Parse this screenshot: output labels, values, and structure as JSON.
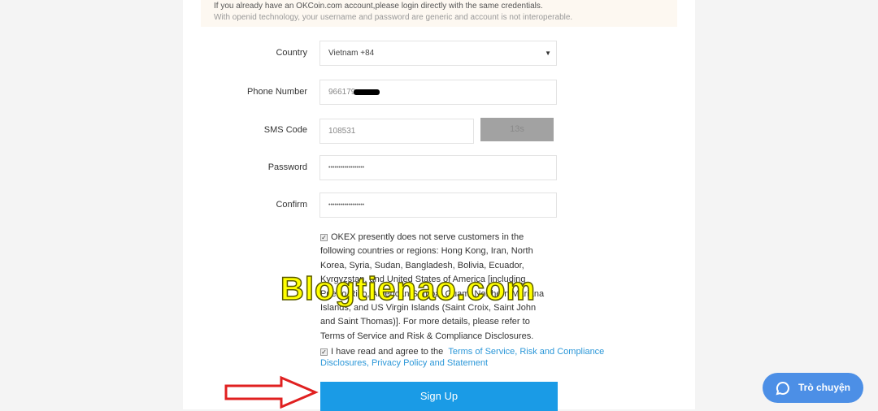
{
  "notice": {
    "line1": "If you already have an OKCoin.com account,please login directly with the same credentials.",
    "line2": "With openid technology, your username and password are generic and account is not interoperable."
  },
  "form": {
    "country_label": "Country",
    "country_value": "Vietnam +84",
    "phone_label": "Phone Number",
    "phone_value": "966179",
    "sms_label": "SMS Code",
    "sms_value": "108531",
    "sms_button": "13s",
    "password_label": "Password",
    "password_value": "••••••••••••••••••",
    "confirm_label": "Confirm",
    "confirm_value": "••••••••••••••••••",
    "restriction_text": "OKEX presently does not serve customers in the following countries or regions: Hong Kong, Iran, North Korea, Syria, Sudan, Bangladesh, Bolivia, Ecuador, Kyrgyzstan, and United States of America [including Puerto Rico, American Samoa, Guam, Northern Mariana Islands, and US Virgin Islands (Saint Croix, Saint John and Saint Thomas)]. For more details, please refer to Terms of Service and Risk & Compliance Disclosures.",
    "agree_text": "I have read and agree to the",
    "agree_link": "Terms of Service, Risk and Compliance Disclosures, Privacy Policy and Statement",
    "signup_label": "Sign Up"
  },
  "watermark": "Blogtienao.com",
  "chat": {
    "label": "Trò chuyện",
    "color": "#4c8fe6"
  },
  "colors": {
    "primary": "#1a9be6",
    "link": "#2b97d8",
    "annotation_arrow": "#e02020"
  }
}
